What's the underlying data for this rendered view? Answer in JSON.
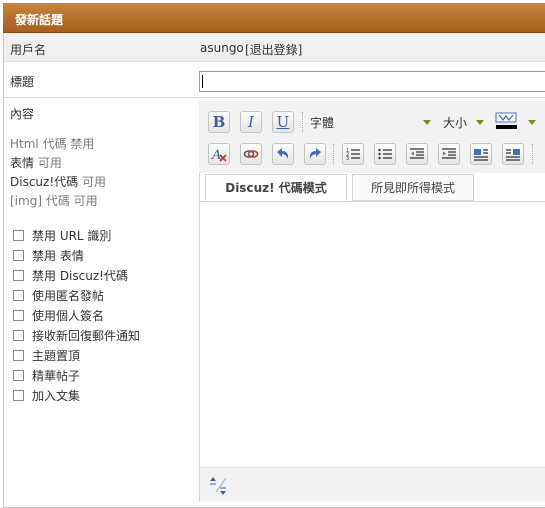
{
  "header": {
    "title": "發新話題"
  },
  "user_row": {
    "label": "用戶名",
    "username": "asungo",
    "logout": "[退出登錄]"
  },
  "title_row": {
    "label": "標題",
    "value": ""
  },
  "content": {
    "label": "內容",
    "settings": [
      {
        "name": "Html 代碼",
        "state": "禁用"
      },
      {
        "name": "表情",
        "state": "可用"
      },
      {
        "name": "Discuz!代碼",
        "state": "可用"
      },
      {
        "name": "[img] 代碼",
        "state": "可用"
      }
    ],
    "options": [
      "禁用 URL 識別",
      "禁用 表情",
      "禁用 Discuz!代碼",
      "使用匿名發帖",
      "使用個人簽名",
      "接收新回復郵件通知",
      "主題置頂",
      "精華帖子",
      "加入文集"
    ]
  },
  "editor": {
    "font_label": "字體",
    "size_label": "大小",
    "tabs": [
      "Discuz! 代碼模式",
      "所見即所得模式"
    ],
    "active_tab": 0,
    "accent": "#3d5e99",
    "header_color": "#b06a25"
  }
}
